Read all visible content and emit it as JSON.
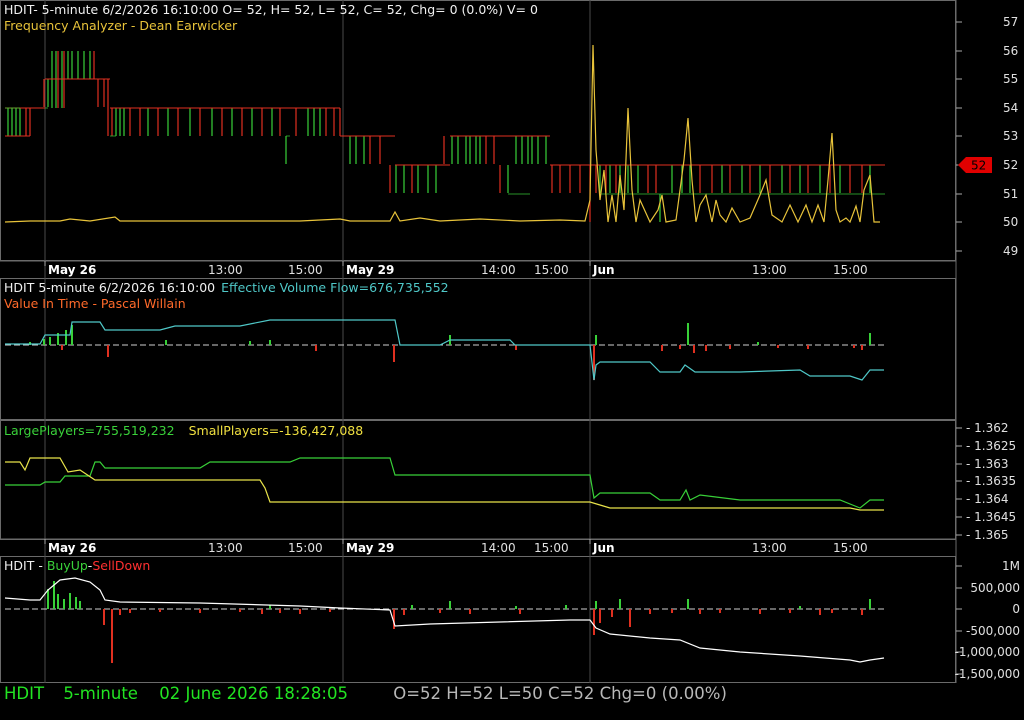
{
  "panel1": {
    "title": "HDIT- 5-minute 6/2/2026 16:10:00 O= 52, H= 52, L= 52, C= 52, Chg= 0 (0.0%) V= 0",
    "indicator": "Frequency Analyzer - Dean Earwicker",
    "y_ticks": [
      "57",
      "56",
      "55",
      "54",
      "53",
      "52",
      "51",
      "50",
      "49"
    ],
    "last_price": "52"
  },
  "time_axis": {
    "dates": [
      "May 26",
      "May 29",
      "Jun"
    ],
    "times": [
      "13:00",
      "15:00",
      "14:00",
      "15:00",
      "13:00",
      "15:00"
    ]
  },
  "panel2": {
    "title": "HDIT 5-minute  6/2/2026 16:10:00",
    "evf": "Effective Volume Flow=676,735,552",
    "indicator": "Value In Time - Pascal Willain"
  },
  "panel3": {
    "large": "LargePlayers=755,519,232",
    "small": "SmallPlayers=-136,427,088",
    "y_ticks": [
      "- 1.362",
      "- 1.3625",
      "- 1.363",
      "- 1.3635",
      "- 1.364",
      "- 1.3645",
      "- 1.365"
    ]
  },
  "panel4": {
    "symbol": "HDIT - ",
    "buy": "BuyUp",
    "dash": "-",
    "sell": "SellDown",
    "y_ticks": [
      "1M",
      "500,000",
      "0",
      "-500,000",
      "-1,000,000",
      "-1,500,000"
    ]
  },
  "status": {
    "symbol": "HDIT",
    "interval": "5-minute",
    "datetime": "02 June 2026 18:28:05",
    "ohlc": "O=52  H=52  L=50  C=52  Chg=0 (0.00%)"
  },
  "colors": {
    "bull": "#38d038",
    "bear": "#e03020",
    "freq": "#e8c33a",
    "grid": "#5a5a5a"
  }
}
